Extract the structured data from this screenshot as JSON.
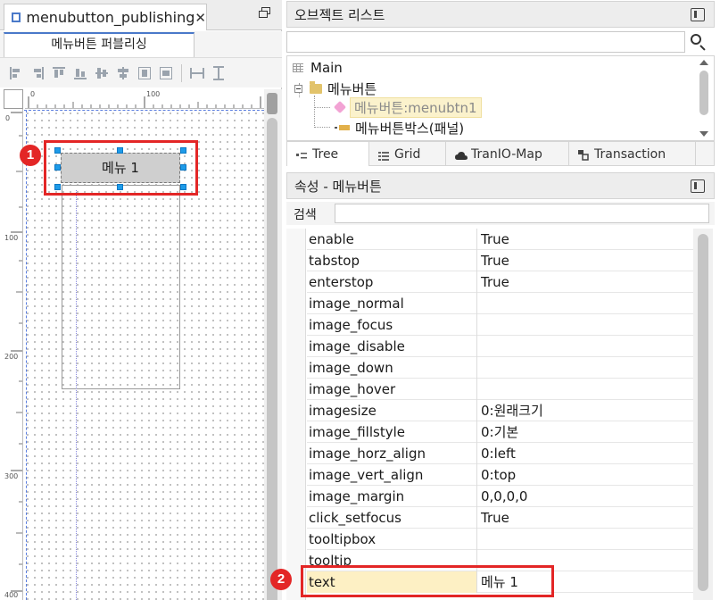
{
  "left": {
    "doc_tab_label": "menubutton_publishing",
    "doc_tab_close": "✕",
    "sub_tab_label": "메뉴버튼 퍼블리싱",
    "ruler_h_labels": [
      "0",
      "100"
    ],
    "ruler_v_labels": [
      "0",
      "100",
      "200",
      "300",
      "400"
    ],
    "menu_button_text": "메뉴 1"
  },
  "right": {
    "object_list_title": "오브젝트 리스트",
    "search_placeholder": "",
    "tree": {
      "root": "Main",
      "folder": "메뉴버튼",
      "child_selected": "메뉴버튼:menubtn1",
      "child2": "메뉴버튼박스(패널)"
    },
    "tabs": [
      "Tree",
      "Grid",
      "TranIO-Map",
      "Transaction"
    ],
    "props_title": "속성 - 메뉴버튼",
    "props_search_label": "검색",
    "props": [
      {
        "name": "enable",
        "value": "True"
      },
      {
        "name": "tabstop",
        "value": "True"
      },
      {
        "name": "enterstop",
        "value": "True"
      },
      {
        "name": "image_normal",
        "value": ""
      },
      {
        "name": "image_focus",
        "value": ""
      },
      {
        "name": "image_disable",
        "value": ""
      },
      {
        "name": "image_down",
        "value": ""
      },
      {
        "name": "image_hover",
        "value": ""
      },
      {
        "name": "imagesize",
        "value": "0:원래크기"
      },
      {
        "name": "image_fillstyle",
        "value": "0:기본"
      },
      {
        "name": "image_horz_align",
        "value": "0:left"
      },
      {
        "name": "image_vert_align",
        "value": "0:top"
      },
      {
        "name": "image_margin",
        "value": "0,0,0,0"
      },
      {
        "name": "click_setfocus",
        "value": "True"
      },
      {
        "name": "tooltipbox",
        "value": ""
      },
      {
        "name": "tooltip",
        "value": ""
      },
      {
        "name": "text",
        "value": "메뉴 1"
      }
    ]
  },
  "annotations": {
    "badge1": "1",
    "badge2": "2"
  },
  "colors": {
    "accent": "#4a79c9",
    "highlight": "#e32626",
    "selection_handle": "#1e9be8"
  }
}
